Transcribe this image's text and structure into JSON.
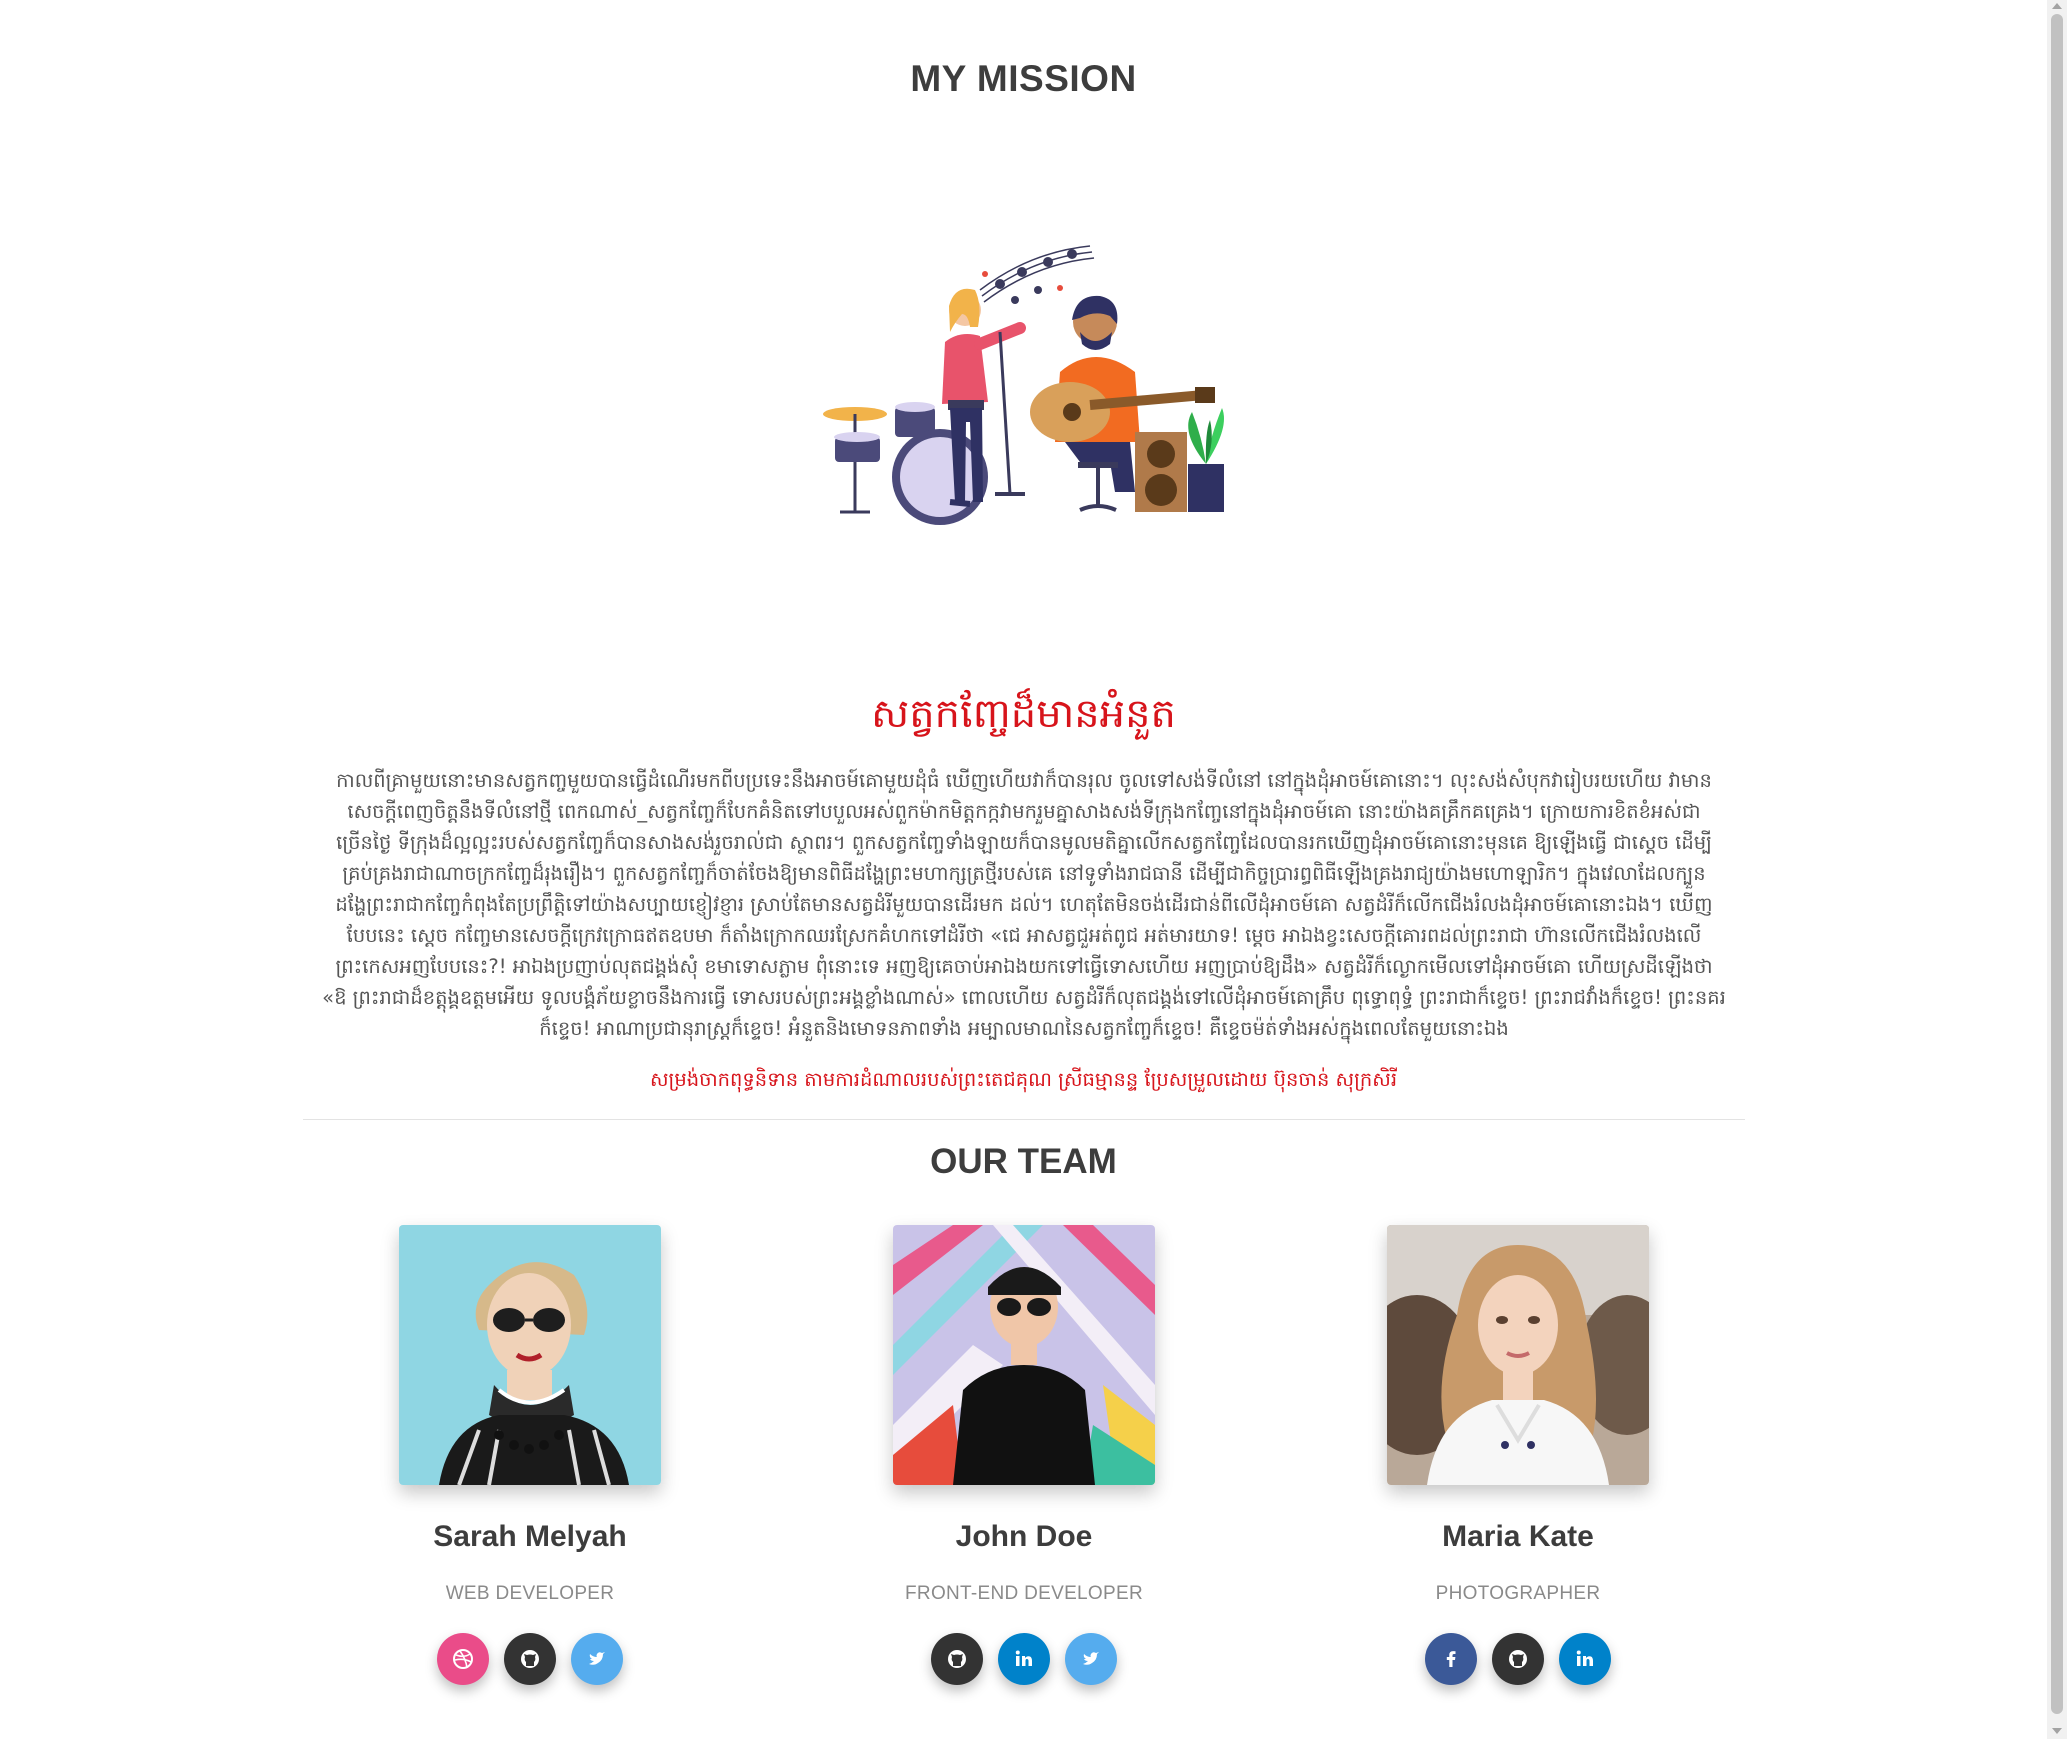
{
  "mission": {
    "title": "MY MISSION"
  },
  "story": {
    "title": "សត្វកញ្ចែដ៏មានអំនួត",
    "body": "កាលពីគ្រាមួយនោះមានសត្វកញ្ចមួយបានធ្វើដំណើរមកពីបប្រទេះនឹងអាចម៍គោមួយដុំធំ ឃើញហើយវាក៏បានរុល ចូលទៅសង់ទីលំនៅ នៅក្នុងដុំអាចម៍គោនោះ។ លុះសង់សំបុកវារៀបរយហើយ វាមាន\nសេចក្ដីពេញចិត្តនឹងទីលំនៅថ្មី ពេកណាស់_សត្វកញ្ចែក៏បែកគំនិតទៅបបួលអស់ពួកម៉ាកមិត្តកក្កវាមករួមគ្នាសាងសង់ទីក្រុងកញ្ចែនៅក្នុងដុំអាចម៍គោ នោះយ៉ាងគគ្រឹកគគ្រេង។ ក្រោយការខិតខំអស់ជា\nច្រើនថ្ងៃ ទីក្រុងដ៏ល្អល្អះរបស់សត្វកញ្ចែក៏បានសាងសង់រួចរាល់ជា ស្ថាពរ។ ពួកសត្វកញ្ចែទាំងឡាយក៏បានមូលមតិគ្នាលើកសត្វកញ្ចែដែលបានរកឃើញដុំអាចម៍គោនោះមុនគេ ឱ្យឡើងធ្វើ ជាស្ដេច ដើម្បី\nគ្រប់គ្រងរាជាណាចក្រកញ្ចែដ៏រុងរឿង។ ពួកសត្វកញ្ចែក៏ចាត់ចែងឱ្យមានពិធីដង្ហែព្រះមហាក្សត្រថ្មីរបស់គេ នៅទូទាំងរាជធានី ដើម្បីជាកិច្ចប្រារព្ធពិធីឡើងគ្រងរាជ្យយ៉ាងមហោឡារិក។ ក្នុងវេលាដែលក្បួន\nដង្ហែព្រះរាជាកញ្ចែកំពុងតែប្រព្រឹត្តិទៅយ៉ាងសប្បាយខ្ញៀវខ្ញារ ស្រាប់តែមានសត្វដំរីមួយបានដើរមក ដល់។ ហេតុតែមិនចង់ដើរជាន់ពីលើដុំអាចម៍គោ សត្វដំរីក៏លើកជើងរំលងដុំអាចម៍គោនោះឯង។ ឃើញ\nបែបនេះ ស្ដេច កញ្ចែមានសេចក្ដីក្រេវក្រោធឥតឧបមា ក៏តាំងក្រោកឈរស្រែកគំហកទៅដំរីថា «ជេ អាសត្វជួអត់ពូជ អត់មារយាទ! ម្ដេច អាឯងខ្វះសេចក្ដីគោរពដល់ព្រះរាជា ហ៊ានលើកជើងរំលងលើ\nព្រះកេសអញបែបនេះ?! អាឯងប្រញាប់លុតជង្គង់សុំ ខមាទោសភ្លាម ពុំនោះទេ អញឱ្យគេចាប់អាឯងយកទៅធ្វើទោសហើយ អញប្រាប់ឱ្យដឹង» សត្វដំរីក៏ល្ងោកមើលទៅដុំអាចម៍គោ ហើយស្រដីឡើងថា\n«ឱ ព្រះរាជាដ៏ខត្តុង្គឧត្ដមអើយ ទូលបង្គំភ័យខ្លាចនឹងការធ្វើ ទោសរបស់ព្រះអង្គខ្លាំងណាស់» ពោលហើយ សត្វដំរីក៏លុតជង្គង់ទៅលើដុំអាចម៍គោគ្រឹប ពុទ្ធោពុទ្ធំ ព្រះរាជាក៏ខ្ទេច! ព្រះរាជវាំងក៏ខ្ទេច! ព្រះនគរ\nក៏ខ្ទេច! អាណាប្រជានុរាស្ត្រក៏ខ្ទេច! អំនួតនិងមោទនភាពទាំង អម្បាលមាណនៃសត្វកញ្ចែក៏ខ្ទេច! គឺខ្ទេចម៉ត់ទាំងអស់ក្នុងពេលតែមួយនោះឯង",
    "source": "សម្រង់ចាកពុទ្ធនិទាន តាមការដំណាលរបស់ព្រះតេជគុណ ស្រីធម្មានន្ទ ប្រែសម្រួលដោយ ប៊ុនចាន់ សុក្រសិរី"
  },
  "team": {
    "title": "OUR TEAM",
    "members": [
      {
        "name": "Sarah Melyah",
        "role": "WEB DEVELOPER",
        "socials": [
          "dribbble-icon",
          "github-icon",
          "twitter-icon"
        ]
      },
      {
        "name": "John Doe",
        "role": "FRONT-END DEVELOPER",
        "socials": [
          "github-icon",
          "linkedin-icon",
          "twitter-icon"
        ]
      },
      {
        "name": "Maria Kate",
        "role": "PHOTOGRAPHER",
        "socials": [
          "facebook-icon",
          "github-icon",
          "linkedin-icon"
        ]
      }
    ]
  },
  "colors": {
    "accent_red": "#d7141b",
    "dribbble": "#ea4c89",
    "github": "#333333",
    "twitter": "#55acee",
    "linkedin": "#0082ca",
    "facebook": "#3b5998"
  }
}
